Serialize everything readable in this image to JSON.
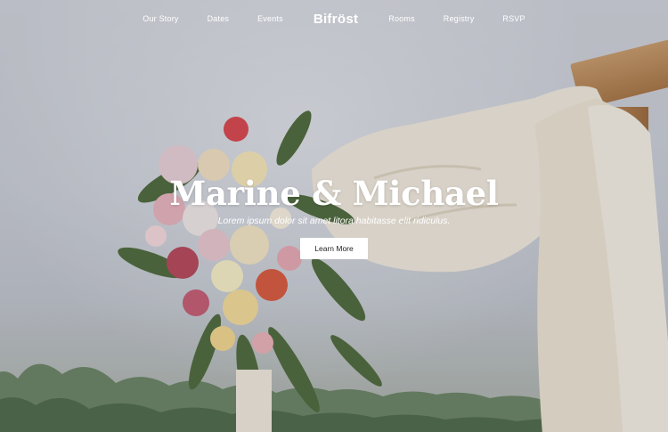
{
  "nav": {
    "left_links": [
      "Our Story",
      "Dates",
      "Events"
    ],
    "brand": "Bifröst",
    "right_links": [
      "Rooms",
      "Registry",
      "RSVP"
    ]
  },
  "hero": {
    "title": "Marine & Michael",
    "subtitle": "Lorem ipsum dolor sit amet litora habitasse elit ridiculus.",
    "cta_label": "Learn More"
  },
  "colors": {
    "sky": "#cdd0d8",
    "text": "#ffffff",
    "button_bg": "#ffffff",
    "button_text": "#222222"
  }
}
